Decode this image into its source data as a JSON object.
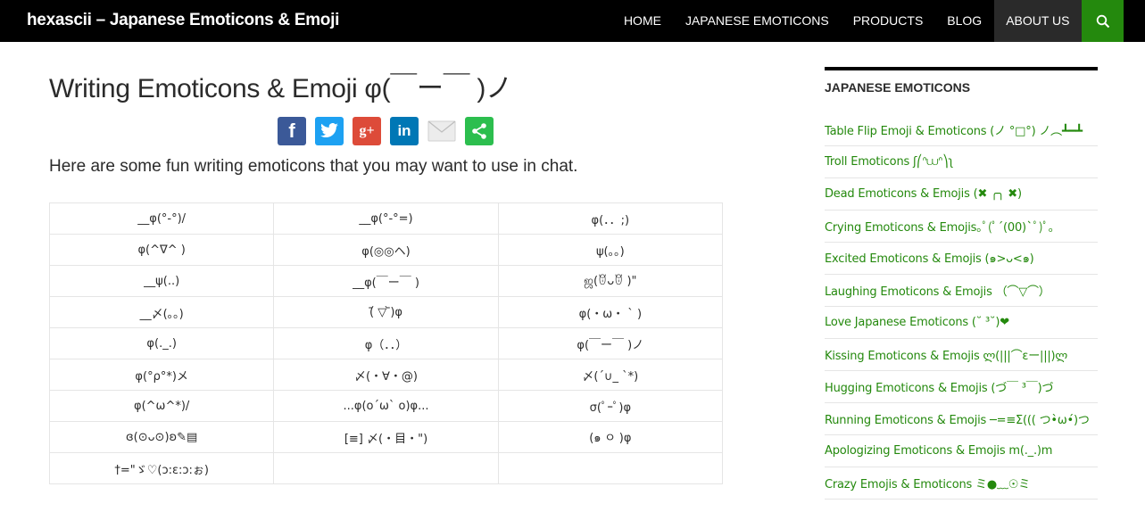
{
  "header": {
    "site_title": "hexascii – Japanese Emoticons & Emoji",
    "nav": [
      "HOME",
      "JAPANESE EMOTICONS",
      "PRODUCTS",
      "BLOG",
      "ABOUT US"
    ],
    "active_nav": "ABOUT US",
    "search_icon": "search-icon"
  },
  "main": {
    "title": "Writing Emoticons & Emoji φ(￣ー￣ )ノ",
    "share": {
      "icons": [
        "facebook-icon",
        "twitter-icon",
        "google-plus-icon",
        "linkedin-icon",
        "email-icon",
        "share-icon"
      ],
      "facebook": "f",
      "twitter": "t",
      "googleplus": "g+",
      "linkedin": "in",
      "colors": {
        "facebook": "#3b5998",
        "twitter": "#1da1f2",
        "googleplus": "#dd4b39",
        "linkedin": "#0077b5",
        "email": "#e3e3e3",
        "share": "#2cbe4e"
      }
    },
    "intro": "Here are some fun writing emoticons that you may want to use in chat.",
    "rows": [
      [
        "__φ(°-°)/",
        "__φ(°-°=)",
        "φ(．．;)"
      ],
      [
        "φ(^∇^ )",
        "φ(◎◎ヘ)",
        "ψ(｡｡)"
      ],
      [
        "__ψ(..)",
        "__φ(￣ー￣ )",
        "ஜ(ꆤᴗꆤ )\""
      ],
      [
        "__〆(｡｡)",
        "(᷄ ▽ ᷅)φ",
        "φ(・ω・ ` )"
      ],
      [
        "φ(._.)",
        "φ（．．）",
        "φ(￣ー￣ )ノ"
      ],
      [
        "φ(°ρ°*)メ",
        "〆(・∀・@)",
        "〆(´∪_ `*)"
      ],
      [
        "φ(^ω^*)/",
        "...φ(o´ω` o)φ...",
        "σ(ﾟｰﾟ)φ"
      ],
      [
        "ɞ(⊙ᴗ⊙)ʚ✎▤",
        "[≡] 〆(・目・\")",
        "(๑ ㅇ )φ"
      ],
      [
        "†=\"ゞ♡(ɔ:ε:ɔ:ぉ)",
        "",
        ""
      ]
    ]
  },
  "sidebar": {
    "heading": "JAPANESE EMOTICONS",
    "link_color": "#24890d",
    "items": [
      "Table Flip Emoji & Emoticons (ノ °□°) ノ︵┻━┻",
      "Troll Emoticons ʃ⎛ᐢ⩊ᐢ⎞ʅ",
      "Dead Emoticons & Emojis (✖ ╭╮ ✖)",
      "Crying Emoticons & Emojis｡ﾟ(ﾟ´(00)`ﾟ)ﾟ｡",
      "Excited Emoticons & Emojis (๑>ᴗ<๑)",
      "Laughing Emoticons & Emojis （⌒▽⌒）",
      "Love Japanese Emoticons (˘ ³˘)❤",
      "Kissing Emoticons & Emojis ლ(|||⌒εー|||)ლ",
      "Hugging Emoticons & Emojis (づ￣ ³￣)づ",
      "Running Emoticons & Emojis ─=≡Σ((( つ•̀ω•́)つ",
      "Apologizing Emoticons & Emojis m(._.)m",
      "Crazy Emojis & Emoticons ミ●﹏☉ミ"
    ]
  }
}
